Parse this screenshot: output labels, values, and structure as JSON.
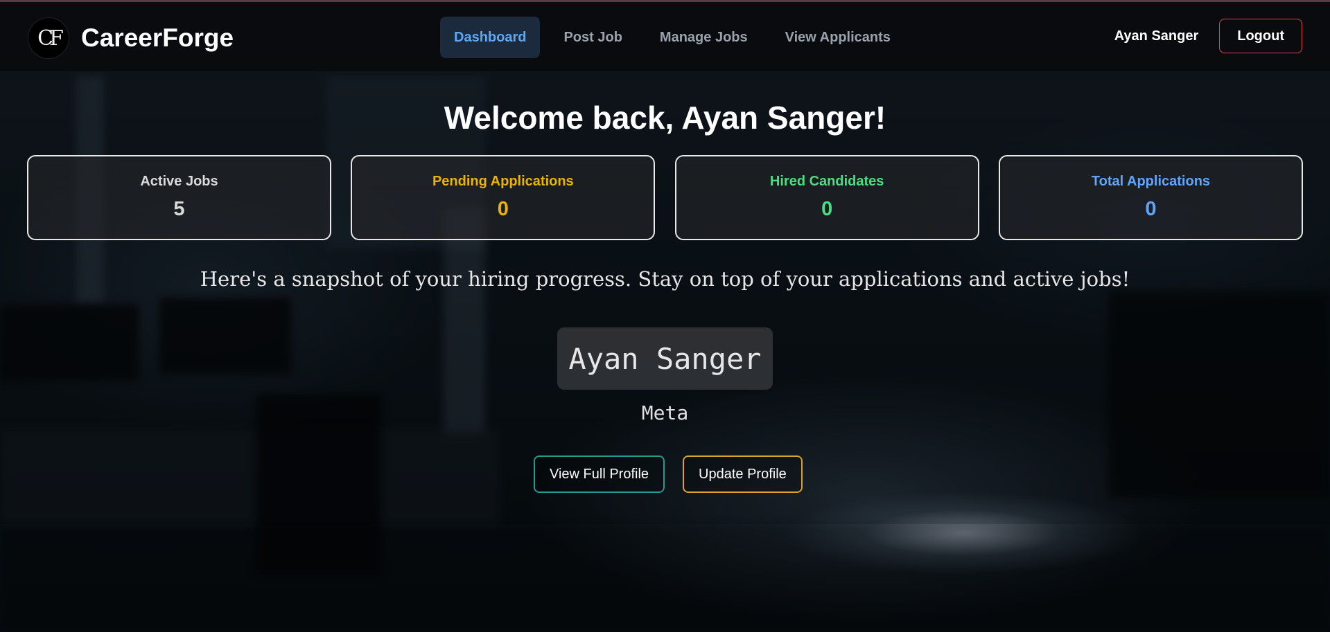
{
  "brand": {
    "logo_text": "CF",
    "name": "CareerForge"
  },
  "nav": {
    "items": [
      {
        "label": "Dashboard",
        "active": true
      },
      {
        "label": "Post Job",
        "active": false
      },
      {
        "label": "Manage Jobs",
        "active": false
      },
      {
        "label": "View Applicants",
        "active": false
      }
    ]
  },
  "user": {
    "name": "Ayan Sanger",
    "logout_label": "Logout"
  },
  "welcome": "Welcome back, Ayan Sanger!",
  "stats": [
    {
      "label": "Active Jobs",
      "value": "5",
      "color": "#d9d9d9"
    },
    {
      "label": "Pending Applications",
      "value": "0",
      "color": "#eab308"
    },
    {
      "label": "Hired Candidates",
      "value": "0",
      "color": "#4ade80"
    },
    {
      "label": "Total Applications",
      "value": "0",
      "color": "#60a5fa"
    }
  ],
  "snapshot_text": "Here's a snapshot of your hiring progress. Stay on top of your applications and active jobs!",
  "profile": {
    "name": "Ayan Sanger",
    "company": "Meta",
    "view_label": "View Full Profile",
    "update_label": "Update Profile"
  },
  "colors": {
    "accent_blue": "#5da8f5",
    "logout_border": "#e0454f",
    "teal": "#1f9b8f",
    "amber": "#e0a126"
  }
}
